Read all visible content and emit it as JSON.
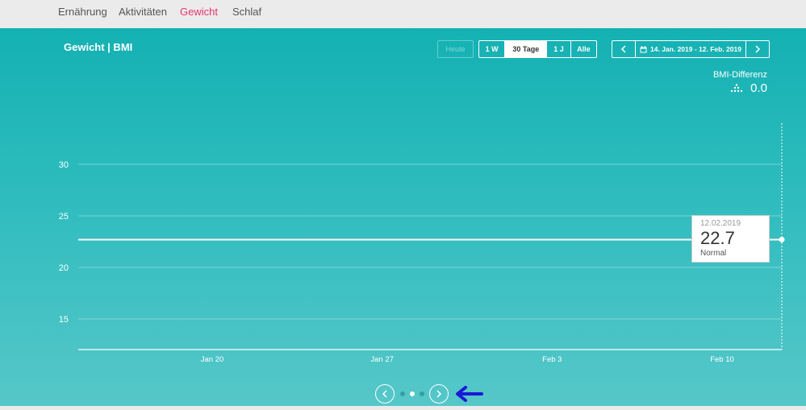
{
  "nav": {
    "items": [
      {
        "label": "Ernährung",
        "active": false
      },
      {
        "label": "Aktivitäten",
        "active": false
      },
      {
        "label": "Gewicht",
        "active": true
      },
      {
        "label": "Schlaf",
        "active": false
      }
    ]
  },
  "header": {
    "title": "Gewicht | BMI"
  },
  "controls": {
    "today_label": "Heute",
    "periods": [
      {
        "label": "1 W",
        "selected": false
      },
      {
        "label": "30 Tage",
        "selected": true
      },
      {
        "label": "1 J",
        "selected": false
      },
      {
        "label": "Alle",
        "selected": false
      }
    ],
    "date_range": "14. Jan. 2019 - 12. Feb. 2019",
    "icons": {
      "prev": "chevron-left-icon",
      "next": "chevron-right-icon",
      "calendar": "calendar-icon"
    }
  },
  "bmi_diff": {
    "label": "BMI-Differenz",
    "value": "0.0"
  },
  "chart_data": {
    "type": "line",
    "y_ticks": [
      30,
      25,
      20,
      15
    ],
    "ylim": [
      12,
      35
    ],
    "x_ticks": [
      {
        "label": "Jan 20",
        "day": 6
      },
      {
        "label": "Jan 27",
        "day": 13
      },
      {
        "label": "Feb 3",
        "day": 20
      },
      {
        "label": "Feb 10",
        "day": 27
      }
    ],
    "x_range_days": [
      0,
      29
    ],
    "series": [
      {
        "points": [
          {
            "day": 0,
            "value": 22.7
          },
          {
            "day": 29,
            "value": 22.7
          }
        ]
      }
    ],
    "grid": true,
    "tooltip": {
      "date": "12.02.2019",
      "value": "22.7",
      "category": "Normal"
    }
  },
  "pager": {
    "count": 3,
    "active": 1
  },
  "colors": {
    "accent": "#e8336e",
    "panel_top": "#14b1b3",
    "panel_bottom": "#56c7c9"
  }
}
